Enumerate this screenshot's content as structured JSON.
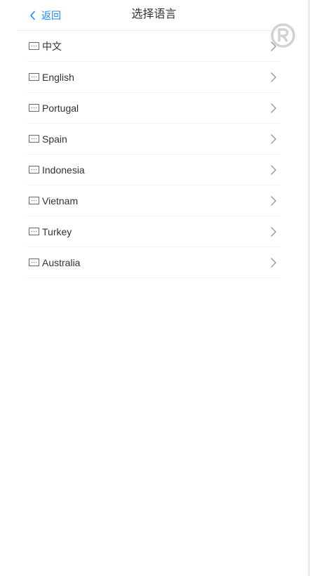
{
  "nav": {
    "back_label": "返回",
    "title": "选择语言"
  },
  "languages": [
    {
      "label": "中文",
      "flag_icon": "flag-placeholder-icon"
    },
    {
      "label": "English",
      "flag_icon": "flag-placeholder-icon"
    },
    {
      "label": "Portugal",
      "flag_icon": "flag-placeholder-icon"
    },
    {
      "label": "Spain",
      "flag_icon": "flag-placeholder-icon"
    },
    {
      "label": "Indonesia",
      "flag_icon": "flag-placeholder-icon"
    },
    {
      "label": "Vietnam",
      "flag_icon": "flag-placeholder-icon"
    },
    {
      "label": "Turkey",
      "flag_icon": "flag-placeholder-icon"
    },
    {
      "label": "Australia",
      "flag_icon": "flag-placeholder-icon"
    }
  ],
  "colors": {
    "accent": "#1989fa",
    "text": "#323233",
    "divider": "#ebedf0",
    "icon_gray": "#969799"
  }
}
